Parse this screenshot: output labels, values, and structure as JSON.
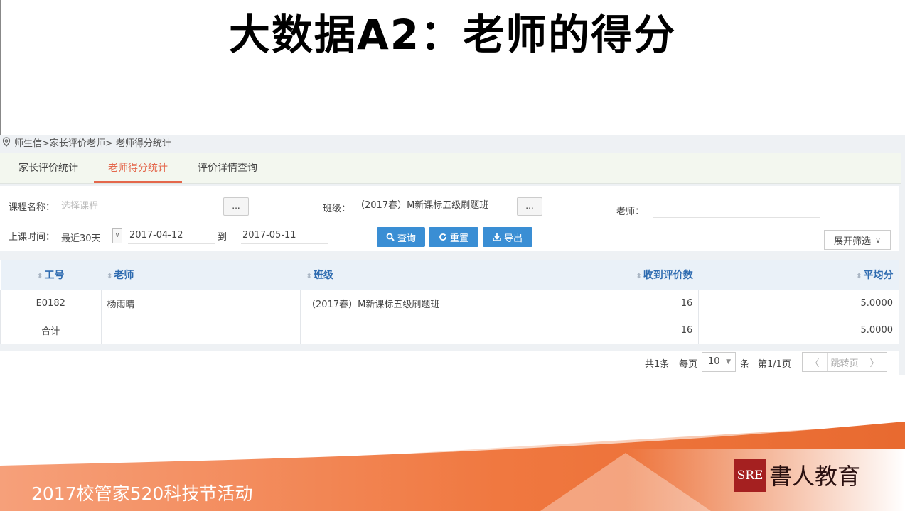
{
  "slide": {
    "title": "大数据A2：老师的得分",
    "footer_text": "2017校管家520科技节活动",
    "logo_mark": "SRE",
    "logo_text": "書人教育"
  },
  "breadcrumb": "师生信>家长评价老师> 老师得分统计",
  "tabs": [
    {
      "label": "家长评价统计",
      "active": false
    },
    {
      "label": "老师得分统计",
      "active": true
    },
    {
      "label": "评价详情查询",
      "active": false
    }
  ],
  "filters": {
    "course_label": "课程名称：",
    "course_placeholder": "选择课程",
    "more_button": "...",
    "class_label": "班级：",
    "class_value": "（2017春）M新课标五级刷题班",
    "teacher_label": "老师：",
    "time_label": "上课时间：",
    "time_range": "最近30天",
    "date_from": "2017-04-12",
    "to_label": "到",
    "date_to": "2017-05-11",
    "query_button": "查询",
    "reset_button": "重置",
    "export_button": "导出",
    "expand_button": "展开筛选"
  },
  "table": {
    "columns": [
      "工号",
      "老师",
      "班级",
      "收到评价数",
      "平均分"
    ],
    "rows": [
      {
        "id": "E0182",
        "teacher": "杨雨晴",
        "class": "（2017春）M新课标五级刷题班",
        "count": "16",
        "avg": "5.0000"
      }
    ],
    "total": {
      "id": "合计",
      "teacher": "",
      "class": "",
      "count": "16",
      "avg": "5.0000"
    }
  },
  "pager": {
    "total": "共1条",
    "per_page_label": "每页",
    "per_page": "10",
    "unit": "条",
    "page_info": "第1/1页",
    "jump_placeholder": "跳转页"
  },
  "colors": {
    "accent": "#e4674c",
    "primary_button": "#3a8ed4",
    "header_text": "#2e6bb0"
  }
}
